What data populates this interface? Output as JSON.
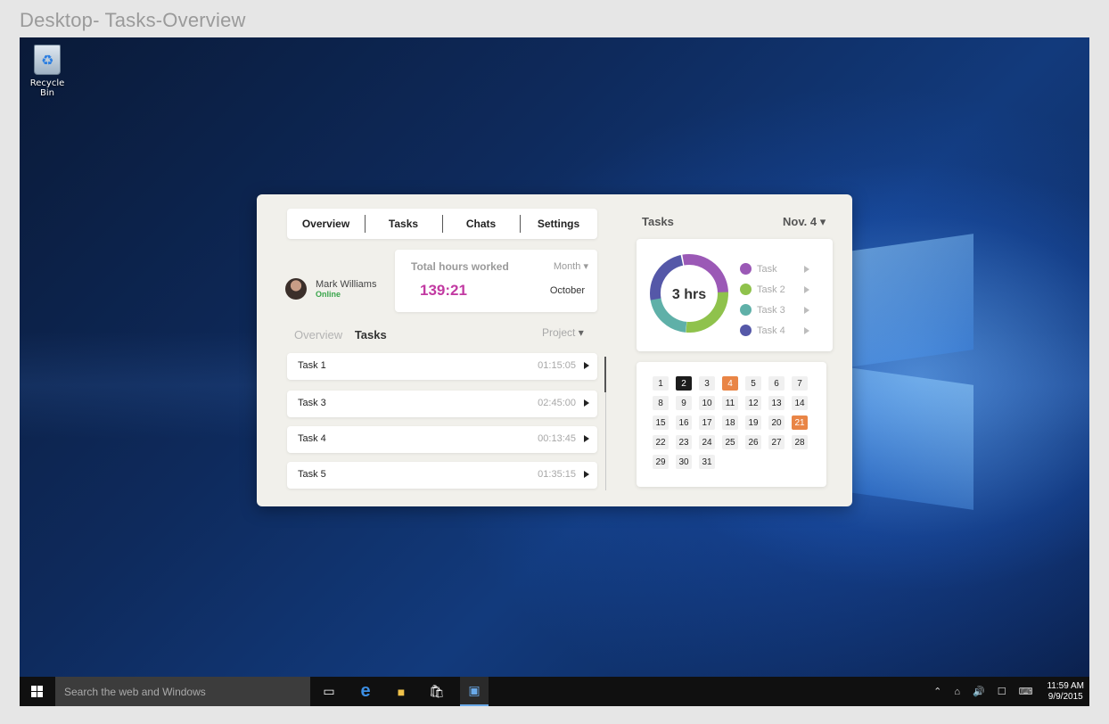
{
  "frame_title": "Desktop- Tasks-Overview",
  "desktop": {
    "recycle_bin_label": "Recycle Bin"
  },
  "app": {
    "tabs": [
      "Overview",
      "Tasks",
      "Chats",
      "Settings"
    ],
    "user": {
      "name": "Mark Williams",
      "status": "Online"
    },
    "hours_card": {
      "title": "Total hours worked",
      "period_select": "Month",
      "value": "139:21",
      "period_value": "October"
    },
    "subnav": {
      "overview": "Overview",
      "tasks": "Tasks",
      "project_select": "Project"
    },
    "tasks": [
      {
        "name": "Task 1",
        "time": "01:15:05"
      },
      {
        "name": "Task 3",
        "time": "02:45:00"
      },
      {
        "name": "Task 4",
        "time": "00:13:45"
      },
      {
        "name": "Task 5",
        "time": "01:35:15"
      }
    ],
    "right": {
      "title": "Tasks",
      "date_select": "Nov. 4",
      "donut_center": "3 hrs",
      "legend": [
        {
          "label": "Task",
          "color": "#9b59b6"
        },
        {
          "label": "Task 2",
          "color": "#8fc24c"
        },
        {
          "label": "Task 3",
          "color": "#5fb0a8"
        },
        {
          "label": "Task  4",
          "color": "#5558a8"
        }
      ],
      "calendar_days": [
        "1",
        "2",
        "3",
        "4",
        "5",
        "6",
        "7",
        "8",
        "9",
        "10",
        "11",
        "12",
        "13",
        "14",
        "15",
        "16",
        "17",
        "18",
        "19",
        "20",
        "21",
        "22",
        "23",
        "24",
        "25",
        "26",
        "27",
        "28",
        "29",
        "30",
        "31"
      ],
      "selected_day": "2",
      "highlighted_days": [
        "4",
        "21"
      ]
    }
  },
  "taskbar": {
    "search_placeholder": "Search the web and Windows",
    "time": "11:59 AM",
    "date": "9/9/2015"
  },
  "colors": {
    "accent_magenta": "#c23aa2",
    "online_green": "#3aa54b",
    "highlight_orange": "#e98546"
  }
}
